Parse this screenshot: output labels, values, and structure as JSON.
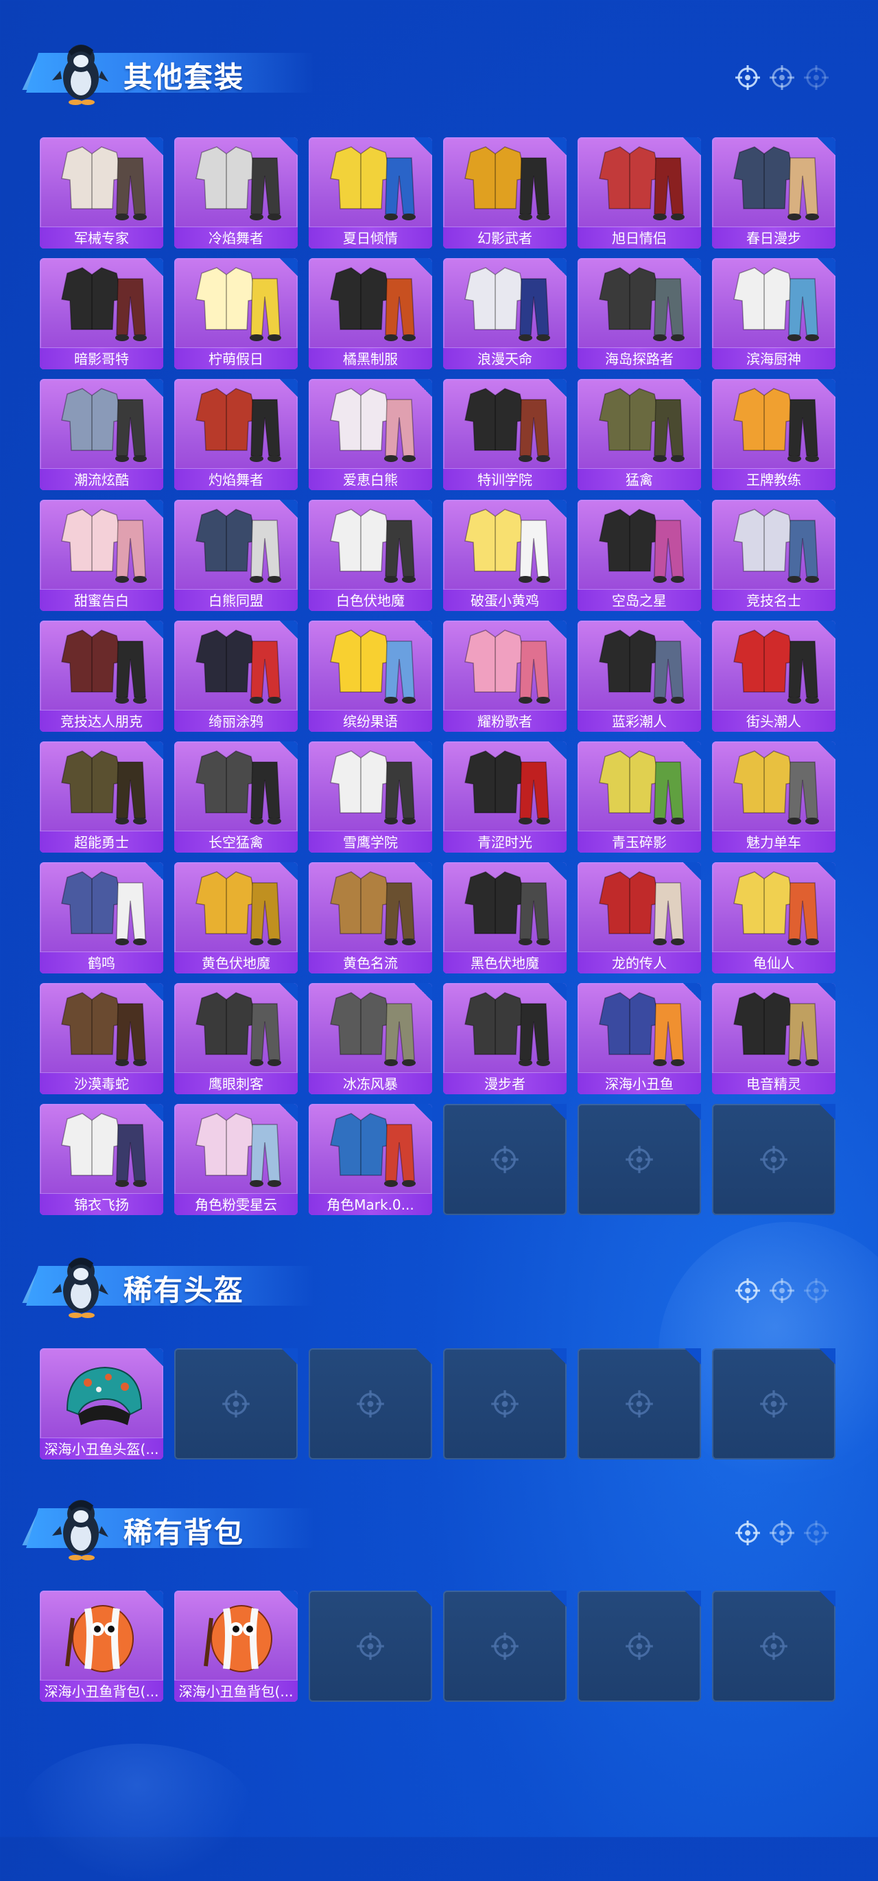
{
  "sections": [
    {
      "title": "其他套装",
      "items": [
        "军械专家",
        "冷焰舞者",
        "夏日倾情",
        "幻影武者",
        "旭日情侣",
        "春日漫步",
        "暗影哥特",
        "柠萌假日",
        "橘黑制服",
        "浪漫天命",
        "海岛探路者",
        "滨海厨神",
        "潮流炫酷",
        "灼焰舞者",
        "爱恵白熊",
        "特训学院",
        "猛禽",
        "王牌教练",
        "甜蜜告白",
        "白熊同盟",
        "白色伏地魔",
        "破蛋小黄鸡",
        "空岛之星",
        "竞技名士",
        "竞技达人朋克",
        "绮丽涂鸦",
        "缤纷果语",
        "耀粉歌者",
        "蓝彩潮人",
        "街头潮人",
        "超能勇士",
        "长空猛禽",
        "雪鹰学院",
        "青涩时光",
        "青玉碎影",
        "魅力单车",
        "鹤鸣",
        "黄色伏地魔",
        "黄色名流",
        "黑色伏地魔",
        "龙的传人",
        "龟仙人",
        "沙漠毒蛇",
        "鹰眼刺客",
        "冰冻风暴",
        "漫步者",
        "深海小丑鱼",
        "电音精灵",
        "锦衣飞扬",
        "角色粉雯星云",
        "角色Mark.0..."
      ],
      "empty_slots": 3
    },
    {
      "title": "稀有头盔",
      "items": [
        "深海小丑鱼头盔(..."
      ],
      "empty_slots": 5
    },
    {
      "title": "稀有背包",
      "items": [
        "深海小丑鱼背包(...",
        "深海小丑鱼背包(..."
      ],
      "empty_slots": 4
    }
  ],
  "icons": {
    "header_decor": "crosshair-icon",
    "empty_slot": "crosshair-icon",
    "mascot": "penguin-avatar"
  },
  "colors": {
    "background": "#0d4fcf",
    "card_purple": "#a65ae0",
    "label_purple": "#8a35e6",
    "empty_slot": "#21446f"
  }
}
